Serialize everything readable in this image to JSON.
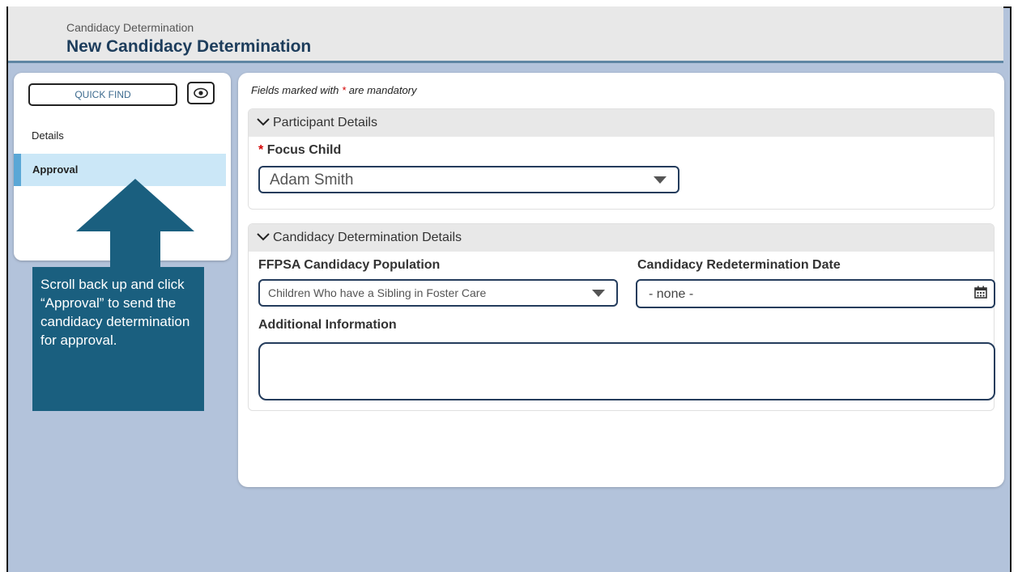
{
  "header": {
    "breadcrumb": "Candidacy Determination",
    "title": "New Candidacy Determination"
  },
  "sidebar": {
    "quick_find": "QUICK FIND",
    "eye_icon": "eye-icon",
    "items": [
      {
        "label": "Details"
      },
      {
        "label": "Approval"
      }
    ]
  },
  "callout": {
    "text": "Scroll back up and click “Approval” to send the candidacy determination for approval."
  },
  "main": {
    "mandatory_prefix": "Fields marked with",
    "mandatory_star": "*",
    "mandatory_suffix": "are mandatory",
    "participant_section": {
      "title": "Participant Details",
      "focus_child_label": "Focus Child",
      "focus_child_value": "Adam Smith"
    },
    "candidacy_section": {
      "title": "Candidacy Determination Details",
      "population_label": "FFPSA Candidacy Population",
      "population_value": "Children Who have a Sibling in Foster Care",
      "redetermination_label": "Candidacy Redetermination Date",
      "redetermination_value": "- none -",
      "additional_label": "Additional Information",
      "additional_value": ""
    }
  },
  "colors": {
    "accent": "#1a5f7f",
    "selected_nav": "#cbe7f7",
    "required": "#d40000",
    "page_bg": "#b3c3db"
  }
}
